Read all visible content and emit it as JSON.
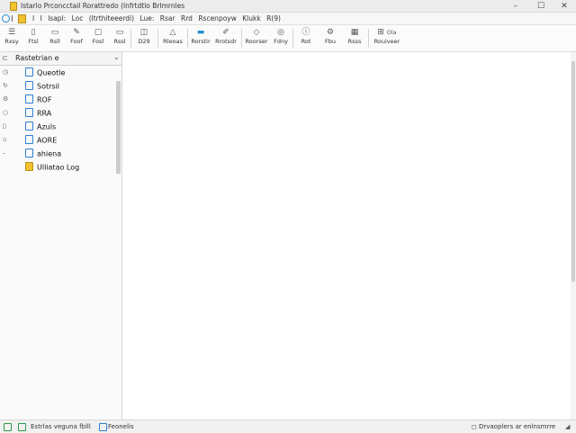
{
  "window": {
    "title": "lstarlo Prconcctail Rorattredo (lnfrtdtlo Brlmrnles",
    "controls": [
      "–",
      "☐",
      "✕"
    ]
  },
  "menubar": {
    "items": [
      "I",
      "I",
      "lsapl:",
      "Loc",
      "(ltrthiteeerdi)",
      "Lue:",
      "Rsar",
      "Rrd",
      "Rscenpoyw",
      "Klukk",
      "R(9)"
    ]
  },
  "toolbar": {
    "buttons": [
      {
        "label": "Rxsy",
        "icon": "list-icon"
      },
      {
        "label": "Ftsl",
        "icon": "doc-icon"
      },
      {
        "label": "Rsll",
        "icon": "folder-icon"
      },
      {
        "label": "Foof",
        "icon": "edit-icon"
      },
      {
        "label": "Fosl",
        "icon": "frame-icon"
      },
      {
        "label": "Rssl",
        "icon": "window-icon"
      },
      {
        "label": "D29",
        "icon": "dialog-icon"
      },
      {
        "label": "Rleoas",
        "icon": "triangle-icon"
      },
      {
        "label": "Rorstir",
        "icon": "line-icon"
      },
      {
        "label": "Rrotsdr",
        "icon": "pen-icon"
      },
      {
        "label": "Roorser",
        "icon": "diamond-icon"
      },
      {
        "label": "Fdny",
        "icon": "search-icon"
      },
      {
        "label": "Rot",
        "icon": "info-icon"
      },
      {
        "label": "Fbu",
        "icon": "settings-icon"
      },
      {
        "label": "Rsss",
        "icon": "table-icon"
      },
      {
        "label": "Rouiveer",
        "icon": "grid-icon"
      }
    ],
    "extra_label": "Ola"
  },
  "sidebar": {
    "header": "Rastetrian e",
    "items": [
      {
        "label": "Queotle"
      },
      {
        "label": "Sotrsil"
      },
      {
        "label": "ROF"
      },
      {
        "label": "RRA"
      },
      {
        "label": "Azuls"
      },
      {
        "label": "AORE"
      },
      {
        "label": "ahiena"
      },
      {
        "label": "Ulliatao Log"
      }
    ]
  },
  "statusbar": {
    "left_text": "Estrlas veguna fblll",
    "middle_text": "Feonelis",
    "right_text": "Drvaoplers ar enlnsmrre"
  }
}
